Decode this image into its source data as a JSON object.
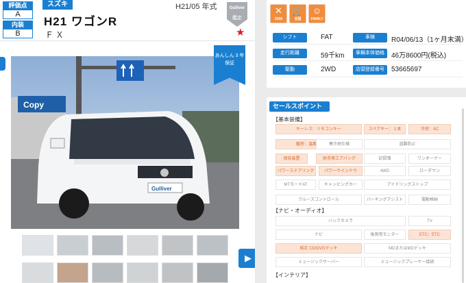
{
  "badges": [
    {
      "label": "評価点",
      "value": "A"
    },
    {
      "label": "内装",
      "value": "B"
    }
  ],
  "vehicle": {
    "maker": "スズキ",
    "model": "H21 ワゴンR",
    "grade": "ＦＸ",
    "year": "H21/05 年式",
    "kantei_logo": "Gulliver",
    "kantei_label": "鑑定"
  },
  "photo": {
    "anshin_label": "あんしん 3 年保証"
  },
  "icons": [
    {
      "name": "award-2008-icon",
      "glyph": "✕",
      "label": "2008",
      "color": "#f28c3a"
    },
    {
      "name": "cart-icon",
      "glyph": "🛒",
      "label": "全国",
      "color": "#f28c3a"
    },
    {
      "name": "family-icon",
      "glyph": "☺",
      "label": "FAMILY",
      "color": "#f28c3a"
    }
  ],
  "specs": [
    {
      "label": "シフト",
      "value": "FAT"
    },
    {
      "label": "車検",
      "value": "R04/06/13（1ヶ月末満）"
    },
    {
      "label": "走行距離",
      "value": "59千km"
    },
    {
      "label": "車輌本体価格",
      "value": "46万8600円(税込)"
    },
    {
      "label": "駆動",
      "value": "2WD"
    },
    {
      "label": "店頭登録番号",
      "value": "53665697"
    }
  ],
  "sales": {
    "title": "セールスポイント",
    "categories": [
      "【基本装備】",
      "【ナビ・オーディオ】",
      "【インテリア】"
    ],
    "basic": [
      {
        "text": "キーレス：リモコンキー",
        "on": true
      },
      {
        "text": "スペアキー：１本",
        "on": true
      },
      {
        "text": "冷房：AC",
        "on": true
      },
      {
        "text": "暖房：温風",
        "on": true
      },
      {
        "text": "寒冷地仕様",
        "on": false
      },
      {
        "text": "盗難防止",
        "on": false
      },
      {
        "text": "保安装置",
        "on": true
      },
      {
        "text": "助手席エアバッグ",
        "on": true
      },
      {
        "text": "記録簿",
        "on": false
      },
      {
        "text": "ワンオーナー",
        "on": false
      },
      {
        "text": "パワーステアリング",
        "on": true
      },
      {
        "text": "パワーウインドウ",
        "on": true
      },
      {
        "text": "4WD",
        "on": false
      },
      {
        "text": "ローダウン",
        "on": false
      },
      {
        "text": "MTモードAT",
        "on": false
      },
      {
        "text": "キャンピングカー",
        "on": false
      },
      {
        "text": "アイドリングストップ",
        "on": false
      },
      {
        "text": "クルーズコントロール",
        "on": false
      },
      {
        "text": "パーキングアシスト",
        "on": false
      },
      {
        "text": "電動格納",
        "on": false
      }
    ],
    "navi": [
      {
        "text": "バックカメラ",
        "on": false
      },
      {
        "text": "TV",
        "on": false
      },
      {
        "text": "ナビ",
        "on": false
      },
      {
        "text": "後席用モニター",
        "on": false
      },
      {
        "text": "ETC：ETC",
        "on": true
      },
      {
        "text": "純正 CD/DVDデッキ",
        "on": true
      },
      {
        "text": "MDまたはMDデッキ",
        "on": false
      },
      {
        "text": "ミュージックサーバー",
        "on": false
      },
      {
        "text": "ミュージックプレーヤー接続",
        "on": false
      }
    ]
  },
  "thumbnails_count": 12,
  "next_button_label": "▶"
}
